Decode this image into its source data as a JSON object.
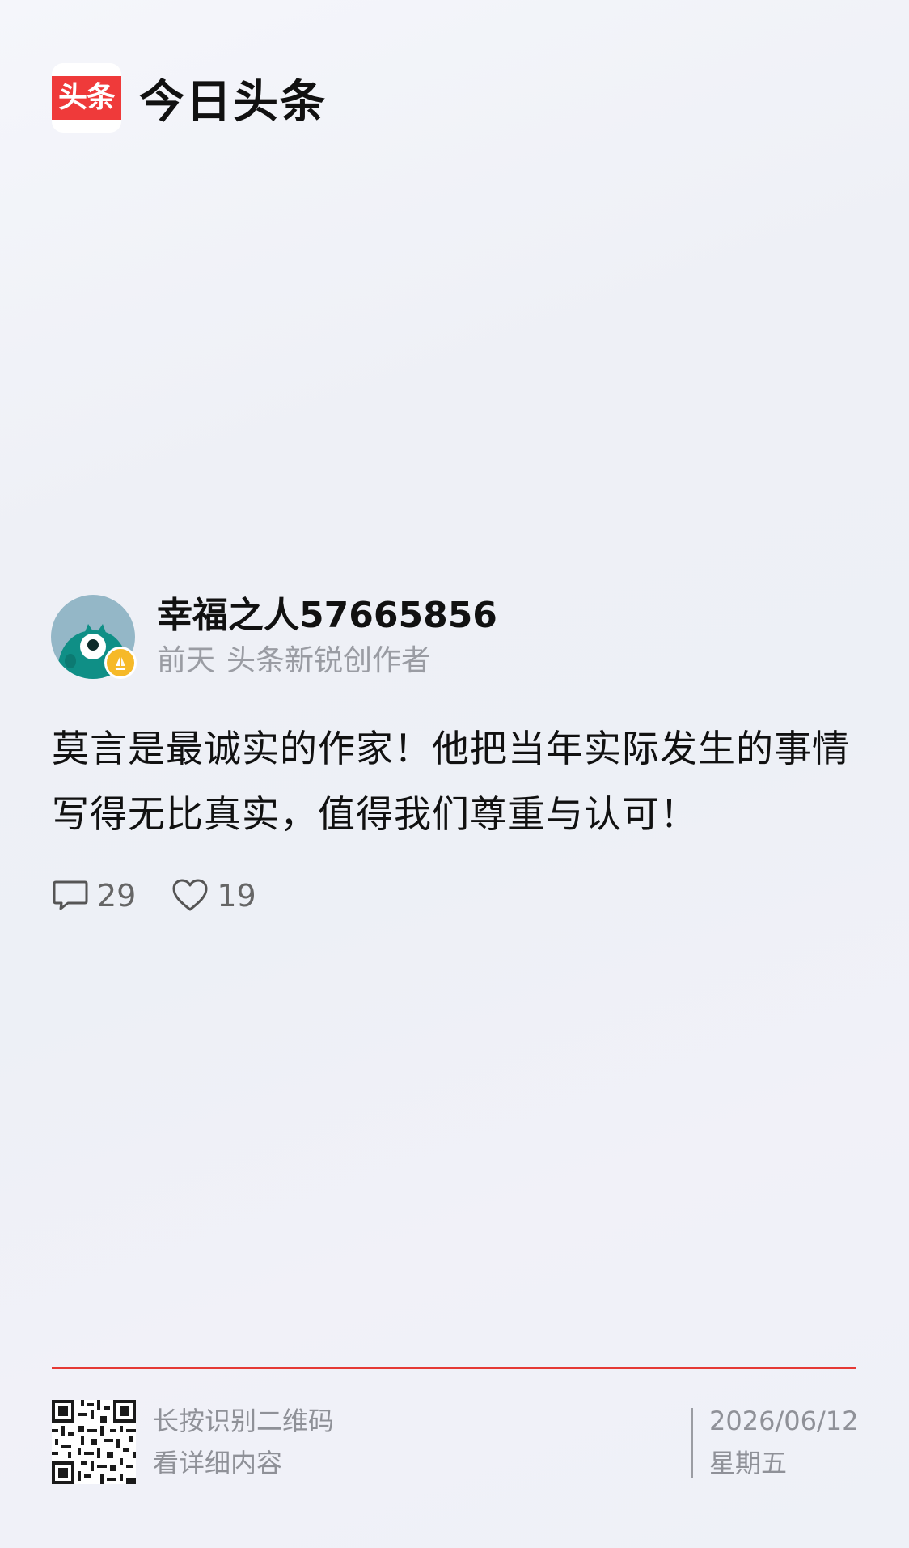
{
  "brand": {
    "logo_text": "头条",
    "name": "今日头条",
    "accent": "#ef3a3a"
  },
  "author": {
    "name": "幸福之人57665856",
    "time": "前天",
    "title": "头条新锐创作者",
    "avatar_icon": "teal-monster-avatar",
    "badge_icon": "creator-badge-icon"
  },
  "post": {
    "text": "莫言是最诚实的作家！他把当年实际发生的事情写得无比真实，值得我们尊重与认可！"
  },
  "stats": {
    "comments": "29",
    "likes": "19"
  },
  "footer": {
    "qr_line1": "长按识别二维码",
    "qr_line2": "看详细内容",
    "date": "2026/06/12",
    "weekday": "星期五",
    "divider_color": "#e53935"
  }
}
